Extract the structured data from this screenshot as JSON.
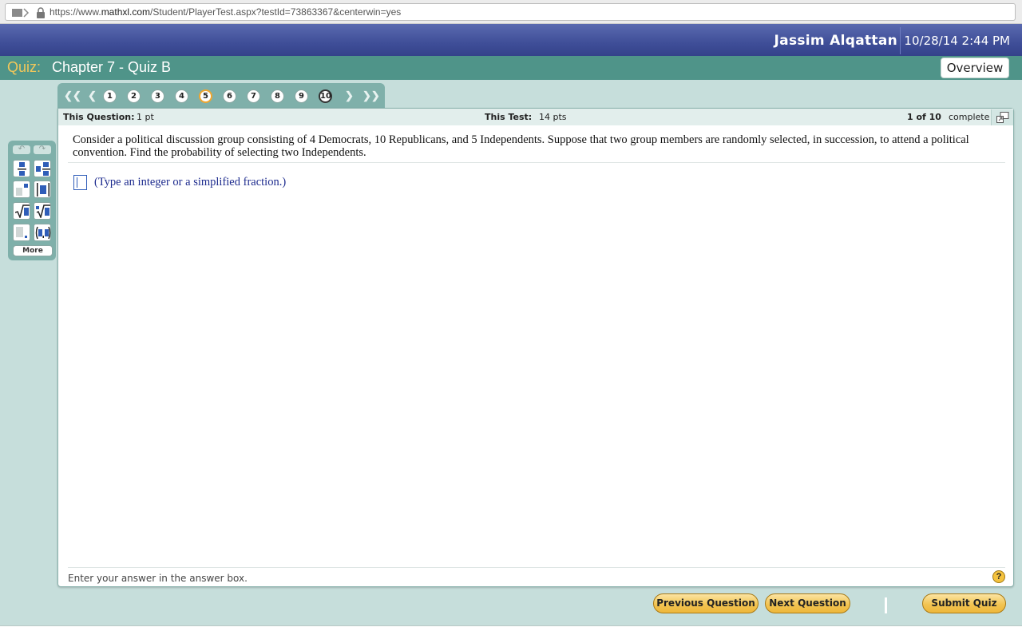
{
  "browser": {
    "url_prefix": "https://www.",
    "url_domain": "mathxl.com",
    "url_path": "/Student/PlayerTest.aspx?testId=73863367&centerwin=yes"
  },
  "header": {
    "user_name": "Jassim Alqattan",
    "datetime": "10/28/14 2:44 PM"
  },
  "titlebar": {
    "quiz_label": "Quiz:",
    "quiz_name": "Chapter 7 - Quiz B",
    "overview_label": "Overview"
  },
  "question_nav": {
    "questions": [
      "1",
      "2",
      "3",
      "4",
      "5",
      "6",
      "7",
      "8",
      "9",
      "10"
    ],
    "current": "5",
    "flagged": "10"
  },
  "infobar": {
    "this_question_label": "This Question:",
    "this_question_value": "1 pt",
    "this_test_label": "This Test:",
    "this_test_value": "14 pts",
    "progress": "1 of 10",
    "progress_suffix": "complete"
  },
  "question": {
    "text": "Consider a political discussion group consisting of 4 Democrats, 10 Republicans, and 5 Independents.  Suppose that two group members are randomly selected, in succession, to attend a political convention.  Find the probability of selecting two Independents.",
    "hint": "(Type an integer or a simplified fraction.)"
  },
  "footer": {
    "message": "Enter your answer in the answer box.",
    "help": "?"
  },
  "palette": {
    "more_label": "More"
  },
  "actions": {
    "previous": "Previous Question",
    "next": "Next Question",
    "submit": "Submit Quiz"
  },
  "colors": {
    "header": "#3f4e98",
    "titlebar": "#4f9489",
    "accent": "#f2c452"
  }
}
